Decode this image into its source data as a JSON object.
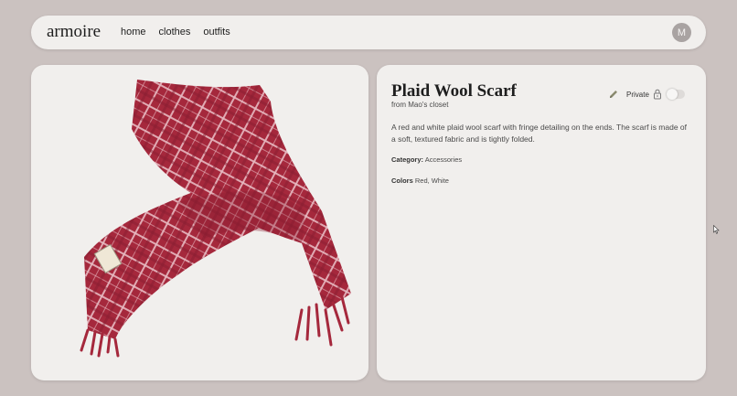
{
  "nav": {
    "brand": "armoire",
    "links": [
      "home",
      "clothes",
      "outfits"
    ],
    "avatar_initial": "M"
  },
  "item": {
    "title": "Plaid Wool Scarf",
    "owner": "from Mao's closet",
    "privacy_label": "Private",
    "private_enabled": false,
    "description": "A red and white plaid wool scarf with fringe detailing on the ends. The scarf is made of a soft, textured fabric and is tightly folded.",
    "category_label": "Category:",
    "category_value": "Accessories",
    "colors_label": "Colors",
    "colors_value": "Red, White",
    "image_alt": "Plaid Wool Scarf"
  },
  "icons": {
    "edit": "pencil-icon",
    "lock": "lock-icon"
  },
  "colors": {
    "page_bg": "#cbc2c0",
    "card_bg": "#f1efed",
    "scarf_red": "#a5283c",
    "scarf_stripe": "#e7b8c0"
  }
}
